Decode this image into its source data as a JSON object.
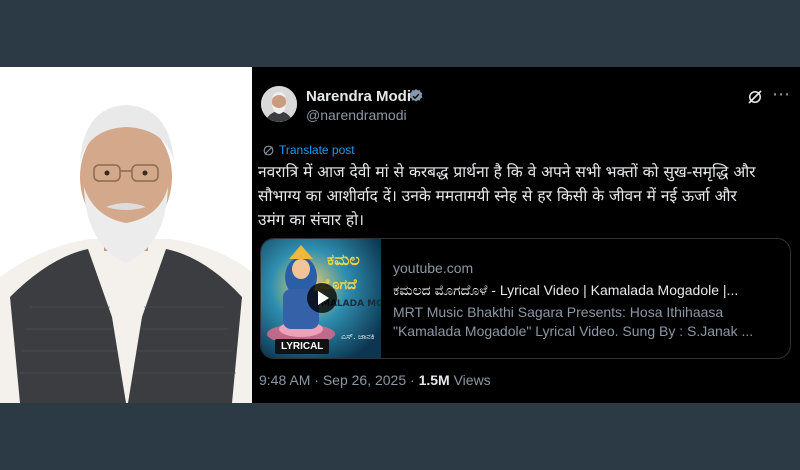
{
  "colors": {
    "background": "#2b3a44",
    "tweet_bg": "#000000",
    "link_blue": "#1d9bf0",
    "muted": "#8b98a5",
    "text": "#e7e9ea"
  },
  "photo": {
    "icon": "portrait-photo"
  },
  "tweet": {
    "display_name": "Narendra Modi",
    "handle": "@narendramodi",
    "verified": true,
    "translate_label": "Translate post",
    "text_line_1": "नवरात्रि में आज देवी मां से करबद्ध प्रार्थना है कि वे अपने सभी भक्तों को सुख-समृद्धि और",
    "text_line_2": "सौभाग्य का आशीर्वाद दें। उनके ममतामयी स्नेह से हर किसी के जीवन में नई ऊर्जा और",
    "text_line_3": "उमंग का संचार हो।",
    "card": {
      "domain": "youtube.com",
      "title": "ಕಮಲದ ಮೊಗದೊಳೆ - Lyrical Video | Kamalada Mogadole |...",
      "description_line_1": "MRT Music Bhakthi Sagara Presents: Hosa Ithihaasa",
      "description_line_2": "\"Kamalada Mogadole\" Lyrical Video. Sung By : S.Janak ...",
      "thumb_title_1": "ಕಮಲ",
      "thumb_title_2": "ಮೊಗದೆ",
      "thumb_subtitle": "MALADA MOG",
      "thumb_badge": "LYRICAL",
      "thumb_singer": "ಎಸ್. ಜಾನಕಿ"
    },
    "time": "9:48 AM",
    "separator": "·",
    "date": "Sep 26, 2025",
    "views_count": "1.5M",
    "views_label": "Views"
  }
}
